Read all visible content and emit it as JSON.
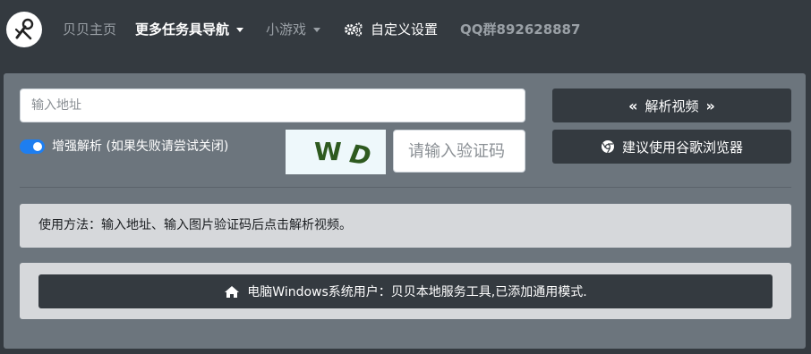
{
  "navbar": {
    "items": [
      {
        "label": "贝贝主页"
      },
      {
        "label": "更多任务具导航"
      },
      {
        "label": "小游戏"
      },
      {
        "label": "自定义设置"
      },
      {
        "label": "QQ群892628887"
      }
    ]
  },
  "form": {
    "url_placeholder": "输入地址",
    "toggle_label": "增强解析 (如果失败请尝试关闭)",
    "toggle_on": true,
    "captcha_chars": [
      "W",
      "D"
    ],
    "captcha_placeholder": "请输入验证码",
    "parse_button": "解析视频",
    "browser_button": "建议使用谷歌浏览器"
  },
  "usage_text": "使用方法：输入地址、输入图片验证码后点击解析视频。",
  "notice_button": "电脑Windows系统用户：贝贝本地服务工具,已添加通用模式.",
  "colors": {
    "navbar_bg": "#343a40",
    "panel_bg": "#6c757d",
    "button_dark": "#343a40",
    "toggle_on": "#1e7ef0",
    "alert_bg": "#d6d8db"
  }
}
